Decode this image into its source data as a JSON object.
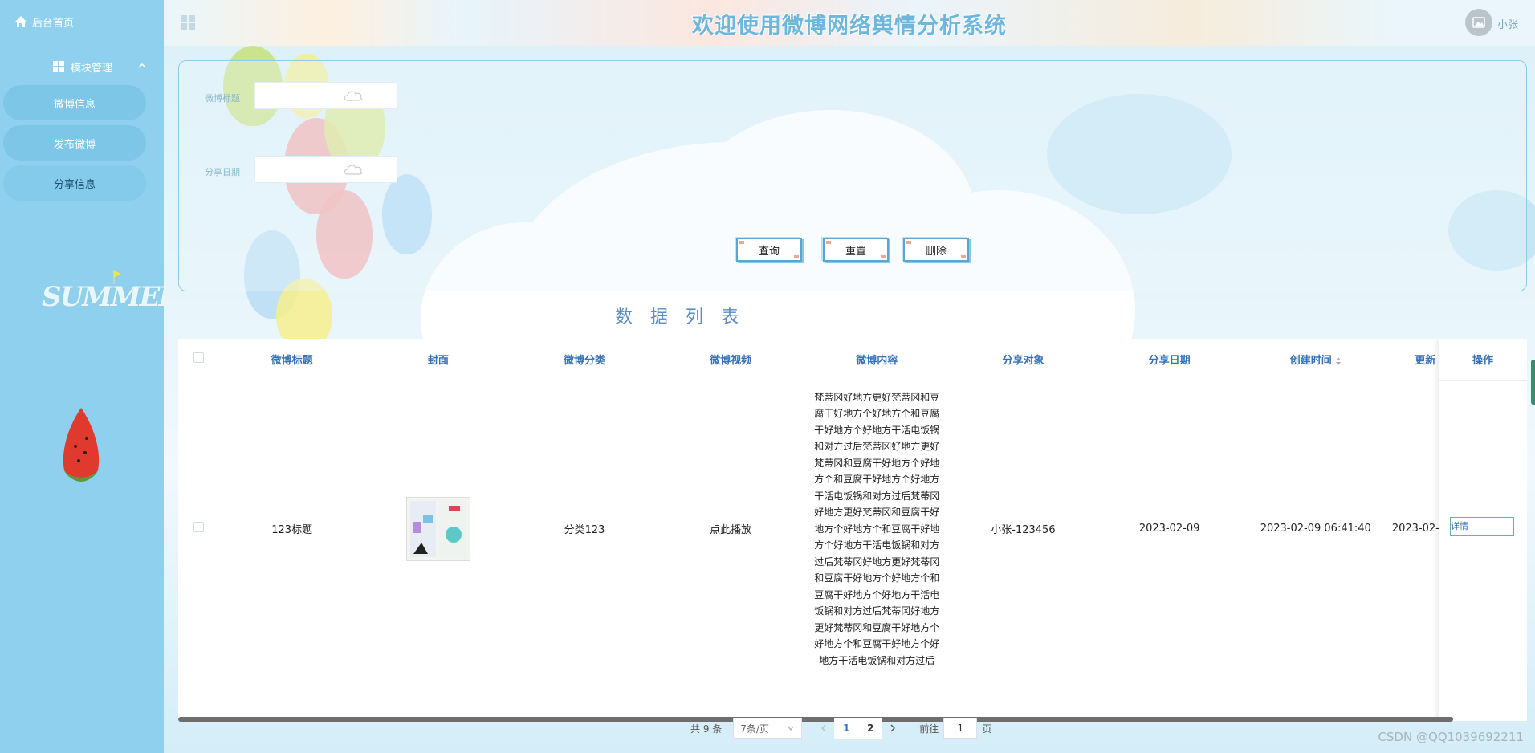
{
  "sidebar": {
    "home": "后台首页",
    "module": "模块管理",
    "items": [
      {
        "label": "微博信息"
      },
      {
        "label": "发布微博"
      },
      {
        "label": "分享信息"
      }
    ],
    "decor_text": "SUMMER"
  },
  "header": {
    "title": "欢迎使用微博网络舆情分析系统",
    "username": "小张"
  },
  "search": {
    "title_label": "微博标题",
    "date_label": "分享日期",
    "query": "查询",
    "reset": "重置",
    "delete": "删除"
  },
  "list_title": "数据列表",
  "table": {
    "columns": [
      "微博标题",
      "封面",
      "微博分类",
      "微博视频",
      "微博内容",
      "分享对象",
      "分享日期",
      "创建时间",
      "更新",
      "操作"
    ],
    "rows": [
      {
        "title": "123标题",
        "category": "分类123",
        "video": "点此播放",
        "content": "梵蒂冈好地方更好梵蒂冈和豆腐干好地方个好地方个和豆腐干好地方个好地方干活电饭锅和对方过后梵蒂冈好地方更好梵蒂冈和豆腐干好地方个好地方个和豆腐干好地方个好地方干活电饭锅和对方过后梵蒂冈好地方更好梵蒂冈和豆腐干好地方个好地方个和豆腐干好地方个好地方干活电饭锅和对方过后梵蒂冈好地方更好梵蒂冈和豆腐干好地方个好地方个和豆腐干好地方个好地方干活电饭锅和对方过后梵蒂冈好地方更好梵蒂冈和豆腐干好地方个好地方个和豆腐干好地方个好地方干活电饭锅和对方过后",
        "share_target": "小张-123456",
        "share_date": "2023-02-09",
        "created": "2023-02-09 06:41:40",
        "updated": "2023-02-",
        "action": "详情"
      }
    ]
  },
  "pager": {
    "total": "共 9 条",
    "page_size": "7条/页",
    "pages": [
      "1",
      "2"
    ],
    "goto_prefix": "前往",
    "goto_value": "1",
    "goto_suffix": "页"
  },
  "watermark": "CSDN @QQ1039692211",
  "colors": {
    "sidebar": "#8fd0ef",
    "title": "#6fb6dc",
    "header_text": "#3672b6"
  }
}
